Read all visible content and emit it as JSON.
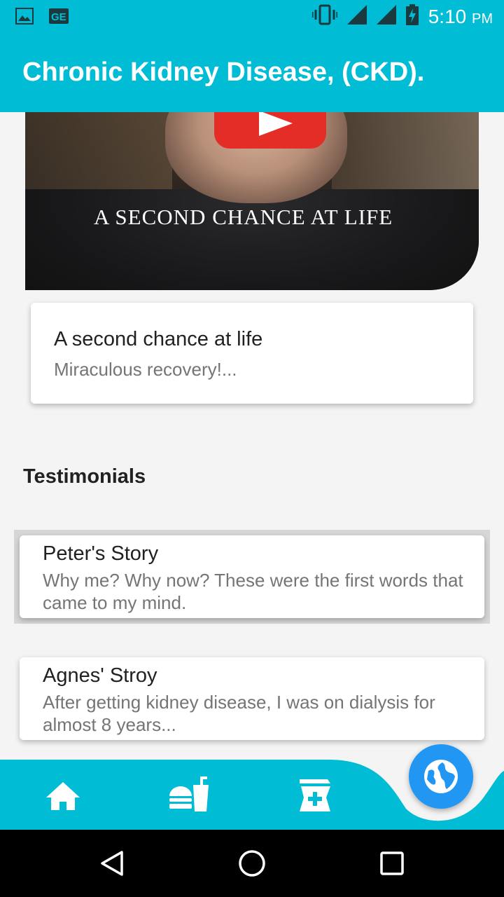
{
  "status_bar": {
    "time": "5:10",
    "ampm": "PM",
    "left_icons": [
      "image-icon",
      "ge-badge-icon"
    ],
    "right_icons": [
      "vibrate-icon",
      "signal-icon",
      "signal-icon",
      "battery-charging-icon"
    ]
  },
  "app_bar": {
    "title": "Chronic Kidney Disease, (CKD)."
  },
  "video": {
    "caption": "A SECOND CHANCE AT LIFE"
  },
  "featured_card": {
    "title": "A second chance at life",
    "subtitle": "Miraculous recovery!..."
  },
  "testimonials": {
    "heading": "Testimonials",
    "items": [
      {
        "title": "Peter's Story",
        "text": " Why me? Why now? These were the first words that came to my mind."
      },
      {
        "title": "Agnes' Stroy",
        "text": "After getting kidney disease, I was on dialysis for almost 8 years..."
      }
    ]
  },
  "bottom_nav": {
    "items": [
      "home-icon",
      "food-icon",
      "pharmacy-icon"
    ],
    "fab": "globe-icon",
    "colors": {
      "bar": "#00bcd4",
      "fab": "#2196f3"
    }
  },
  "system_nav": [
    "back-icon",
    "home-circle-icon",
    "recents-icon"
  ]
}
